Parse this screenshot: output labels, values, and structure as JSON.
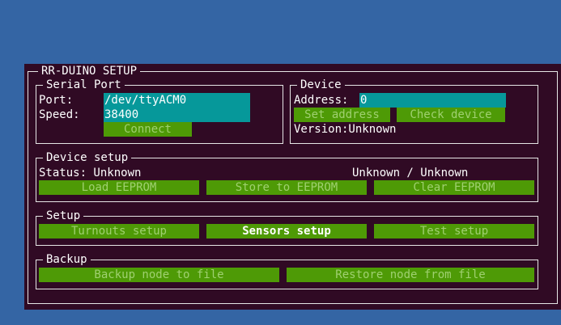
{
  "title": "RR-DUINO SETUP",
  "serial": {
    "legend": "Serial Port",
    "port_label": "Port:",
    "port_value": "/dev/ttyACM0",
    "speed_label": "Speed:",
    "speed_value": "38400",
    "connect_label": "Connect"
  },
  "device": {
    "legend": "Device",
    "address_label": "Address:",
    "address_value": "0",
    "set_address_label": "Set address",
    "check_device_label": "Check device",
    "version_text": "Version:Unknown"
  },
  "device_setup": {
    "legend": "Device setup",
    "status_text": "Status: Unknown",
    "counts_text": "Unknown / Unknown",
    "load_label": "Load EEPROM",
    "store_label": "Store to EEPROM",
    "clear_label": "Clear EEPROM"
  },
  "setup": {
    "legend": "Setup",
    "turnouts_label": "Turnouts setup",
    "sensors_label": "Sensors setup",
    "test_label": "Test setup"
  },
  "backup": {
    "legend": "Backup",
    "backup_label": "Backup node to file",
    "restore_label": "Restore node from file"
  },
  "colors": {
    "desktop": "#3465a4",
    "terminal": "#300a24",
    "field": "#06989a",
    "button": "#4e9a06"
  }
}
